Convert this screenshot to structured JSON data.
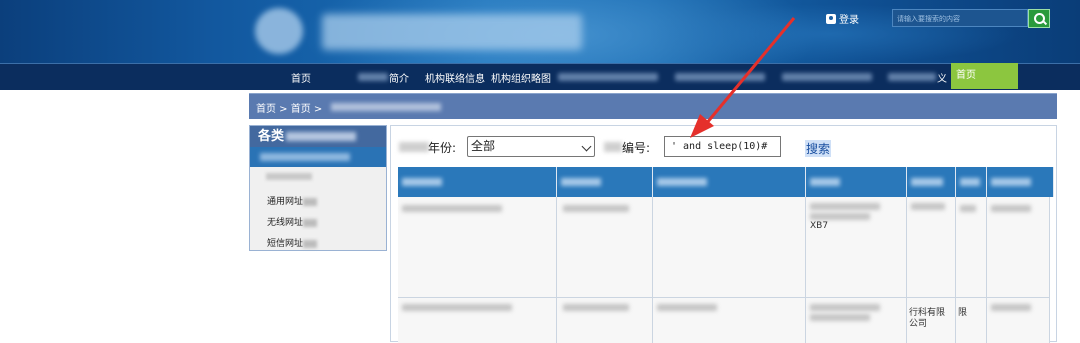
{
  "header": {
    "login_label": "登录",
    "search_placeholder": "请输入要搜索的内容"
  },
  "nav": {
    "items": [
      {
        "label": "首页"
      },
      {
        "label": "简介"
      },
      {
        "label": "机构联络信息"
      },
      {
        "label": "机构组织略图"
      },
      {
        "label": "义"
      }
    ],
    "active_label": "首页"
  },
  "breadcrumb": {
    "text": "首页 > 首页 >"
  },
  "sidebar": {
    "title": "各类",
    "items": [
      {
        "label": "通用网址"
      },
      {
        "label": "无线网址"
      },
      {
        "label": "短信网址"
      }
    ]
  },
  "filter": {
    "year_label": "年份:",
    "year_value": "全部",
    "number_label": "编号:",
    "number_value": "' and sleep(10)#",
    "search_label": "搜索"
  },
  "table": {
    "row2_col4_text": "XB7",
    "row3_col5_text_line1": "行科有限",
    "row3_col5_text_line2": "公司",
    "row3_col6_text": "限"
  },
  "colors": {
    "annotation_arrow": "#e5302b",
    "nav_active": "#8cc63f",
    "table_header": "#2a78ba"
  }
}
